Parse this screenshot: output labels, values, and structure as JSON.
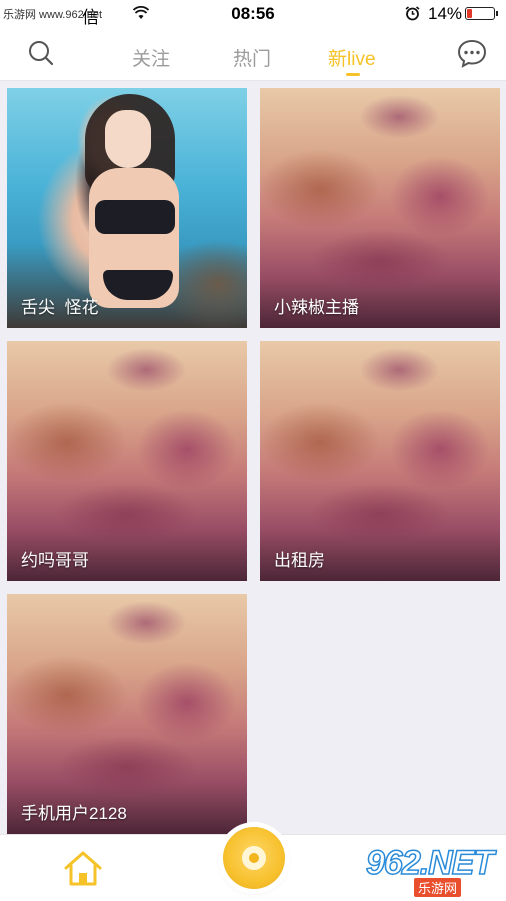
{
  "status_bar": {
    "watermark": "乐游网 www.962.net",
    "carrier_suffix": "信",
    "time": "08:56",
    "battery_percent": "14%"
  },
  "nav": {
    "tabs": [
      {
        "label": "关注",
        "active": false
      },
      {
        "label": "热门",
        "active": false
      },
      {
        "label": "新live",
        "active": true
      }
    ],
    "accent_color": "#f5c227"
  },
  "grid": {
    "tiles": [
      {
        "label": "舌尖  怪花"
      },
      {
        "label": "小辣椒主播"
      },
      {
        "label": "约吗哥哥"
      },
      {
        "label": "出租房"
      },
      {
        "label": "手机用户2128"
      }
    ]
  },
  "tab_bar": {
    "home": "home-icon",
    "live": "live-record-icon"
  },
  "watermark_logo": {
    "main": "962.NET",
    "sub": "乐游网"
  }
}
